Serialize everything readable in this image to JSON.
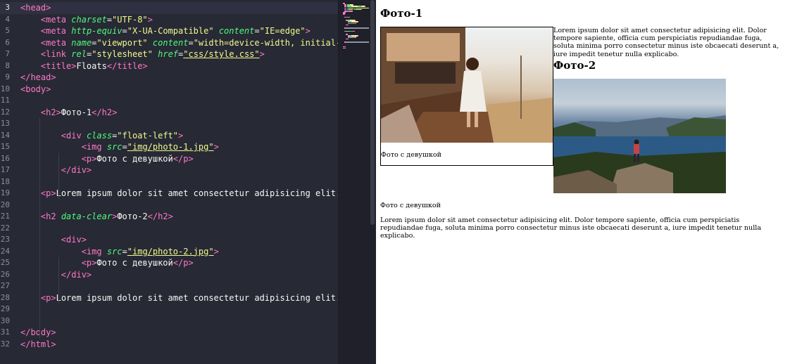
{
  "editor": {
    "lines": [
      {
        "n": "3",
        "tokens": [
          [
            "t",
            "<head>"
          ]
        ]
      },
      {
        "n": "4",
        "tokens": [
          [
            "p",
            "    "
          ],
          [
            "t",
            "<meta"
          ],
          [
            "p",
            " "
          ],
          [
            "a",
            "charset"
          ],
          [
            "p",
            "="
          ],
          [
            "s",
            "\"UTF-8\""
          ],
          [
            "t",
            ">"
          ]
        ]
      },
      {
        "n": "5",
        "tokens": [
          [
            "p",
            "    "
          ],
          [
            "t",
            "<meta"
          ],
          [
            "p",
            " "
          ],
          [
            "a",
            "http-equiv"
          ],
          [
            "p",
            "="
          ],
          [
            "s",
            "\"X-UA-Compatible\""
          ],
          [
            "p",
            " "
          ],
          [
            "a",
            "content"
          ],
          [
            "p",
            "="
          ],
          [
            "s",
            "\"IE=edge\""
          ],
          [
            "t",
            ">"
          ]
        ]
      },
      {
        "n": "6",
        "tokens": [
          [
            "p",
            "    "
          ],
          [
            "t",
            "<meta"
          ],
          [
            "p",
            " "
          ],
          [
            "a",
            "name"
          ],
          [
            "p",
            "="
          ],
          [
            "s",
            "\"viewport\""
          ],
          [
            "p",
            " "
          ],
          [
            "a",
            "content"
          ],
          [
            "p",
            "="
          ],
          [
            "s",
            "\"width=device-width, initial-scal"
          ]
        ]
      },
      {
        "n": "7",
        "tokens": [
          [
            "p",
            "    "
          ],
          [
            "t",
            "<link"
          ],
          [
            "p",
            " "
          ],
          [
            "a",
            "rel"
          ],
          [
            "p",
            "="
          ],
          [
            "s",
            "\"stylesheet\""
          ],
          [
            "p",
            " "
          ],
          [
            "a",
            "href"
          ],
          [
            "p",
            "="
          ],
          [
            "su",
            "\"css/style.css\""
          ],
          [
            "t",
            ">"
          ]
        ]
      },
      {
        "n": "8",
        "tokens": [
          [
            "p",
            "    "
          ],
          [
            "t",
            "<title>"
          ],
          [
            "p",
            "Floats"
          ],
          [
            "t",
            "</title>"
          ]
        ]
      },
      {
        "n": "9",
        "tokens": [
          [
            "t",
            "</head>"
          ]
        ]
      },
      {
        "n": "10",
        "tokens": [
          [
            "t",
            "<body>"
          ]
        ]
      },
      {
        "n": "11",
        "tokens": []
      },
      {
        "n": "12",
        "tokens": [
          [
            "p",
            "    "
          ],
          [
            "t",
            "<h2>"
          ],
          [
            "p",
            "Фото-1"
          ],
          [
            "t",
            "</h2>"
          ]
        ]
      },
      {
        "n": "13",
        "tokens": []
      },
      {
        "n": "14",
        "tokens": [
          [
            "p",
            "        "
          ],
          [
            "t",
            "<div"
          ],
          [
            "p",
            " "
          ],
          [
            "a",
            "class"
          ],
          [
            "p",
            "="
          ],
          [
            "s",
            "\"float-left\""
          ],
          [
            "t",
            ">"
          ]
        ]
      },
      {
        "n": "15",
        "tokens": [
          [
            "p",
            "            "
          ],
          [
            "t",
            "<img"
          ],
          [
            "p",
            " "
          ],
          [
            "a",
            "src"
          ],
          [
            "p",
            "="
          ],
          [
            "su",
            "\"img/photo-1.jpg\""
          ],
          [
            "t",
            ">"
          ]
        ]
      },
      {
        "n": "16",
        "tokens": [
          [
            "p",
            "            "
          ],
          [
            "t",
            "<p>"
          ],
          [
            "p",
            "Фото с девушкой"
          ],
          [
            "t",
            "</p>"
          ]
        ]
      },
      {
        "n": "17",
        "tokens": [
          [
            "p",
            "        "
          ],
          [
            "t",
            "</div>"
          ]
        ]
      },
      {
        "n": "18",
        "tokens": []
      },
      {
        "n": "19",
        "tokens": [
          [
            "p",
            "    "
          ],
          [
            "t",
            "<p>"
          ],
          [
            "p",
            "Lorem ipsum dolor sit amet consectetur adipisicing elit. Dol"
          ]
        ]
      },
      {
        "n": "20",
        "tokens": []
      },
      {
        "n": "21",
        "tokens": [
          [
            "p",
            "    "
          ],
          [
            "t",
            "<h2"
          ],
          [
            "p",
            " "
          ],
          [
            "a",
            "data-clear"
          ],
          [
            "t",
            ">"
          ],
          [
            "p",
            "Фото-2"
          ],
          [
            "t",
            "</h2>"
          ]
        ]
      },
      {
        "n": "22",
        "tokens": []
      },
      {
        "n": "23",
        "tokens": [
          [
            "p",
            "        "
          ],
          [
            "t",
            "<div>"
          ]
        ]
      },
      {
        "n": "24",
        "tokens": [
          [
            "p",
            "            "
          ],
          [
            "t",
            "<img"
          ],
          [
            "p",
            " "
          ],
          [
            "a",
            "src"
          ],
          [
            "p",
            "="
          ],
          [
            "su",
            "\"img/photo-2.jpg\""
          ],
          [
            "t",
            ">"
          ]
        ]
      },
      {
        "n": "25",
        "tokens": [
          [
            "p",
            "            "
          ],
          [
            "t",
            "<p>"
          ],
          [
            "p",
            "Фото с девушкой"
          ],
          [
            "t",
            "</p>"
          ]
        ]
      },
      {
        "n": "26",
        "tokens": [
          [
            "p",
            "        "
          ],
          [
            "t",
            "</div>"
          ]
        ]
      },
      {
        "n": "27",
        "tokens": []
      },
      {
        "n": "28",
        "tokens": [
          [
            "p",
            "    "
          ],
          [
            "t",
            "<p>"
          ],
          [
            "p",
            "Lorem ipsum dolor sit amet consectetur adipisicing elit. Dol"
          ]
        ]
      },
      {
        "n": "29",
        "tokens": []
      },
      {
        "n": "30",
        "tokens": []
      },
      {
        "n": "31",
        "tokens": [
          [
            "t",
            "</body>"
          ]
        ]
      },
      {
        "n": "32",
        "tokens": [
          [
            "t",
            "</html>"
          ]
        ]
      }
    ]
  },
  "preview": {
    "heading1": "Фото-1",
    "caption1": "Фото с девушкой",
    "para1": "Lorem ipsum dolor sit amet consectetur adipisicing elit. Dolor tempore sapiente, officia cum perspiciatis repudiandae fuga, soluta minima porro consectetur minus iste obcaecati deserunt a, iure impedit tenetur nulla explicabo.",
    "heading2": "Фото-2",
    "caption2": "Фото с девушкой",
    "para2": "Lorem ipsum dolor sit amet consectetur adipisicing elit. Dolor tempore sapiente, officia cum perspiciatis repudiandae fuga, soluta minima porro consectetur minus iste obcaecati deserunt a, iure impedit tenetur nulla explicabo."
  },
  "colors": {
    "editor_bg": "#272935",
    "tag": "#ff79c6",
    "attr": "#50fa7b",
    "string": "#f1fa8c",
    "text": "#f8f8f2"
  }
}
